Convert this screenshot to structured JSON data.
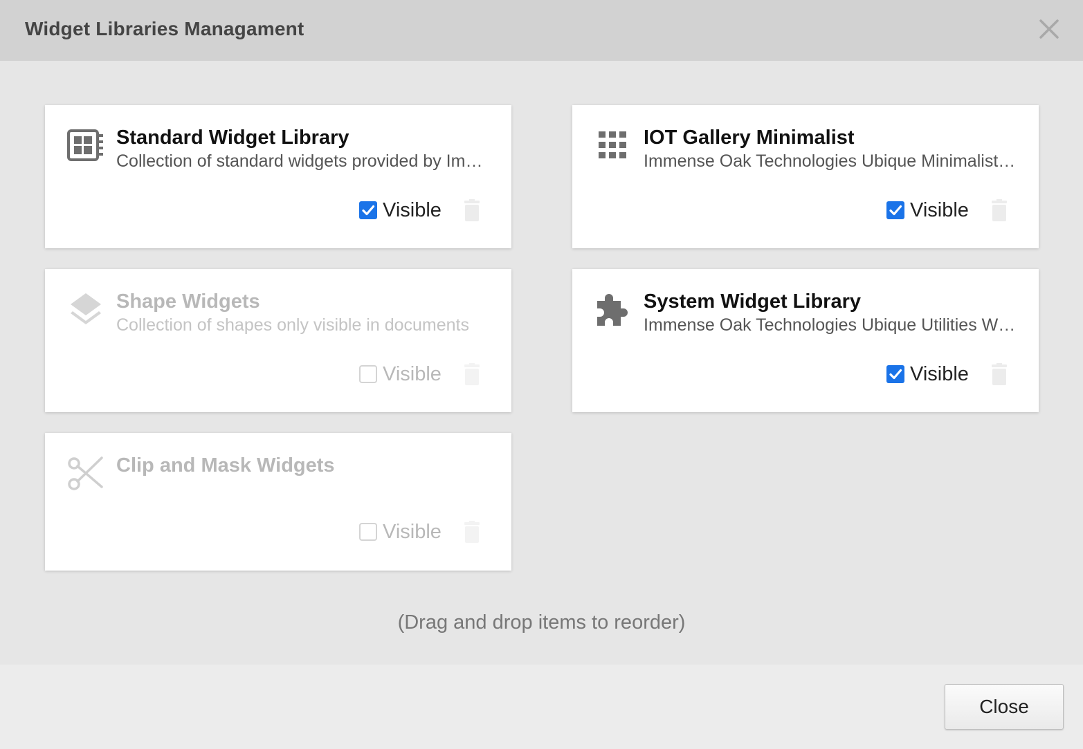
{
  "dialog": {
    "title": "Widget Libraries Managament",
    "close_icon": "close-icon",
    "hint": "(Drag and drop items to reorder)",
    "close_button_label": "Close"
  },
  "colors": {
    "accent": "#1a73e8",
    "header_bg": "#d2d2d2",
    "body_bg": "#e6e6e6",
    "card_bg": "#ffffff"
  },
  "libraries": [
    {
      "name": "Standard Widget Library",
      "description": "Collection of standard widgets provided by Immense Oak Technologies Ubique",
      "icon": "widget-layout-icon",
      "visible": true,
      "visible_label": "Visible",
      "enabled": true
    },
    {
      "name": "IOT Gallery Minimalist",
      "description": "Immense Oak Technologies Ubique Minimalist Gallery",
      "icon": "grid-dots-icon",
      "visible": true,
      "visible_label": "Visible",
      "enabled": true
    },
    {
      "name": "Shape Widgets",
      "description": "Collection of shapes only visible in documents",
      "icon": "layers-icon",
      "visible": false,
      "visible_label": "Visible",
      "enabled": false
    },
    {
      "name": "System Widget Library",
      "description": "Immense Oak Technologies Ubique Utilities Widgets",
      "icon": "puzzle-piece-icon",
      "visible": true,
      "visible_label": "Visible",
      "enabled": true
    },
    {
      "name": "Clip and Mask Widgets",
      "description": "",
      "icon": "scissors-icon",
      "visible": false,
      "visible_label": "Visible",
      "enabled": false
    }
  ]
}
